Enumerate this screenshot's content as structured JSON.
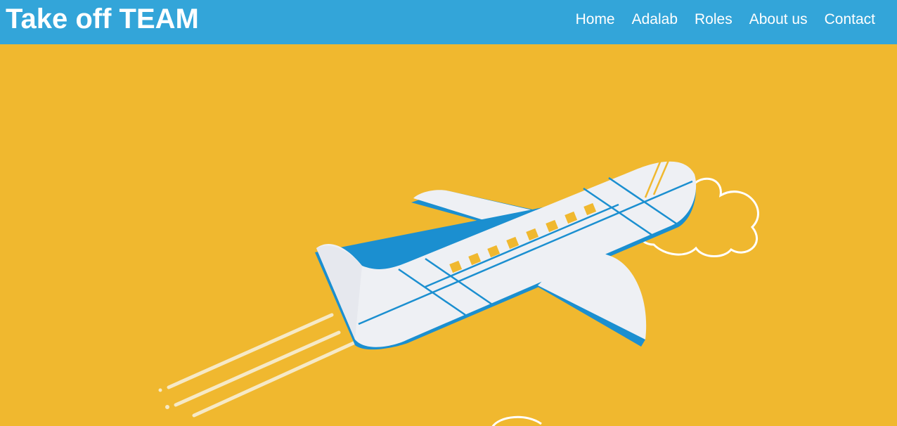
{
  "header": {
    "brand": "Take off TEAM",
    "nav": [
      {
        "label": "Home"
      },
      {
        "label": "Adalab"
      },
      {
        "label": "Roles"
      },
      {
        "label": "About us"
      },
      {
        "label": "Contact"
      }
    ]
  },
  "colors": {
    "header_bg": "#33a5d9",
    "hero_bg": "#f0b82f",
    "plane_body": "#eef0f4",
    "plane_accent": "#1b8fd0"
  },
  "hero": {
    "illustration": "airplane-icon"
  }
}
